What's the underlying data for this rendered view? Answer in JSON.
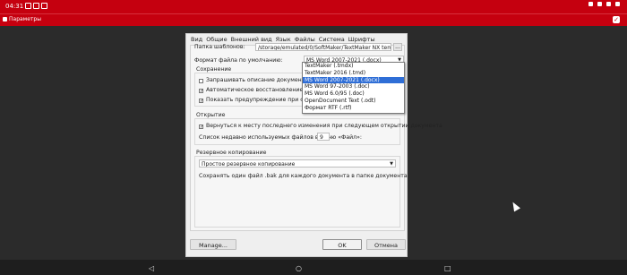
{
  "status": {
    "time": "04:31"
  },
  "titlebar": {
    "title": "Параметры"
  },
  "tabs": [
    "Вид",
    "Общие",
    "Внешний вид",
    "Язык",
    "Файлы",
    "Система",
    "Шрифты"
  ],
  "active_tab": "Файлы",
  "templates": {
    "label": "Папка шаблонов:",
    "path": "/storage/emulated/0/SoftMaker/TextMaker NX templat",
    "browse": "..."
  },
  "default_format": {
    "label": "Формат файла по умолчанию:",
    "value": "MS Word 2007-2021 (.docx)",
    "options": [
      "TextMaker (.tmdx)",
      "TextMaker 2016 (.tmd)",
      "MS Word 2007-2021 (.docx)",
      "MS Word 97-2003 (.doc)",
      "MS Word 6.0/95 (.doc)",
      "OpenDocument Text (.odt)",
      "Формат RTF (.rtf)"
    ],
    "selected_index": 2
  },
  "saving": {
    "title": "Сохранение",
    "items": [
      {
        "label": "Запрашивать описание документа пр",
        "checked": false
      },
      {
        "label": "Автоматическое восстановление: сох",
        "checked": true
      },
      {
        "label": "Показать предупреждение при сохран",
        "checked": true
      }
    ],
    "trailing": "te"
  },
  "opening": {
    "title": "Открытие",
    "item": {
      "label": "Вернуться к месту последнего изменения при следующем открытии документа",
      "checked": true
    },
    "recent_label": "Список недавно используемых файлов в меню «Файл»:",
    "recent_value": "9"
  },
  "backup": {
    "title": "Резервное копирование",
    "value": "Простое резервное копирование",
    "description": "Сохранять один файл .bak для каждого документа в папке документа"
  },
  "buttons": {
    "manage": "Manage...",
    "ok": "OK",
    "cancel": "Отмена"
  },
  "nav": {
    "back": "◁",
    "home": "○",
    "recents": "□"
  }
}
